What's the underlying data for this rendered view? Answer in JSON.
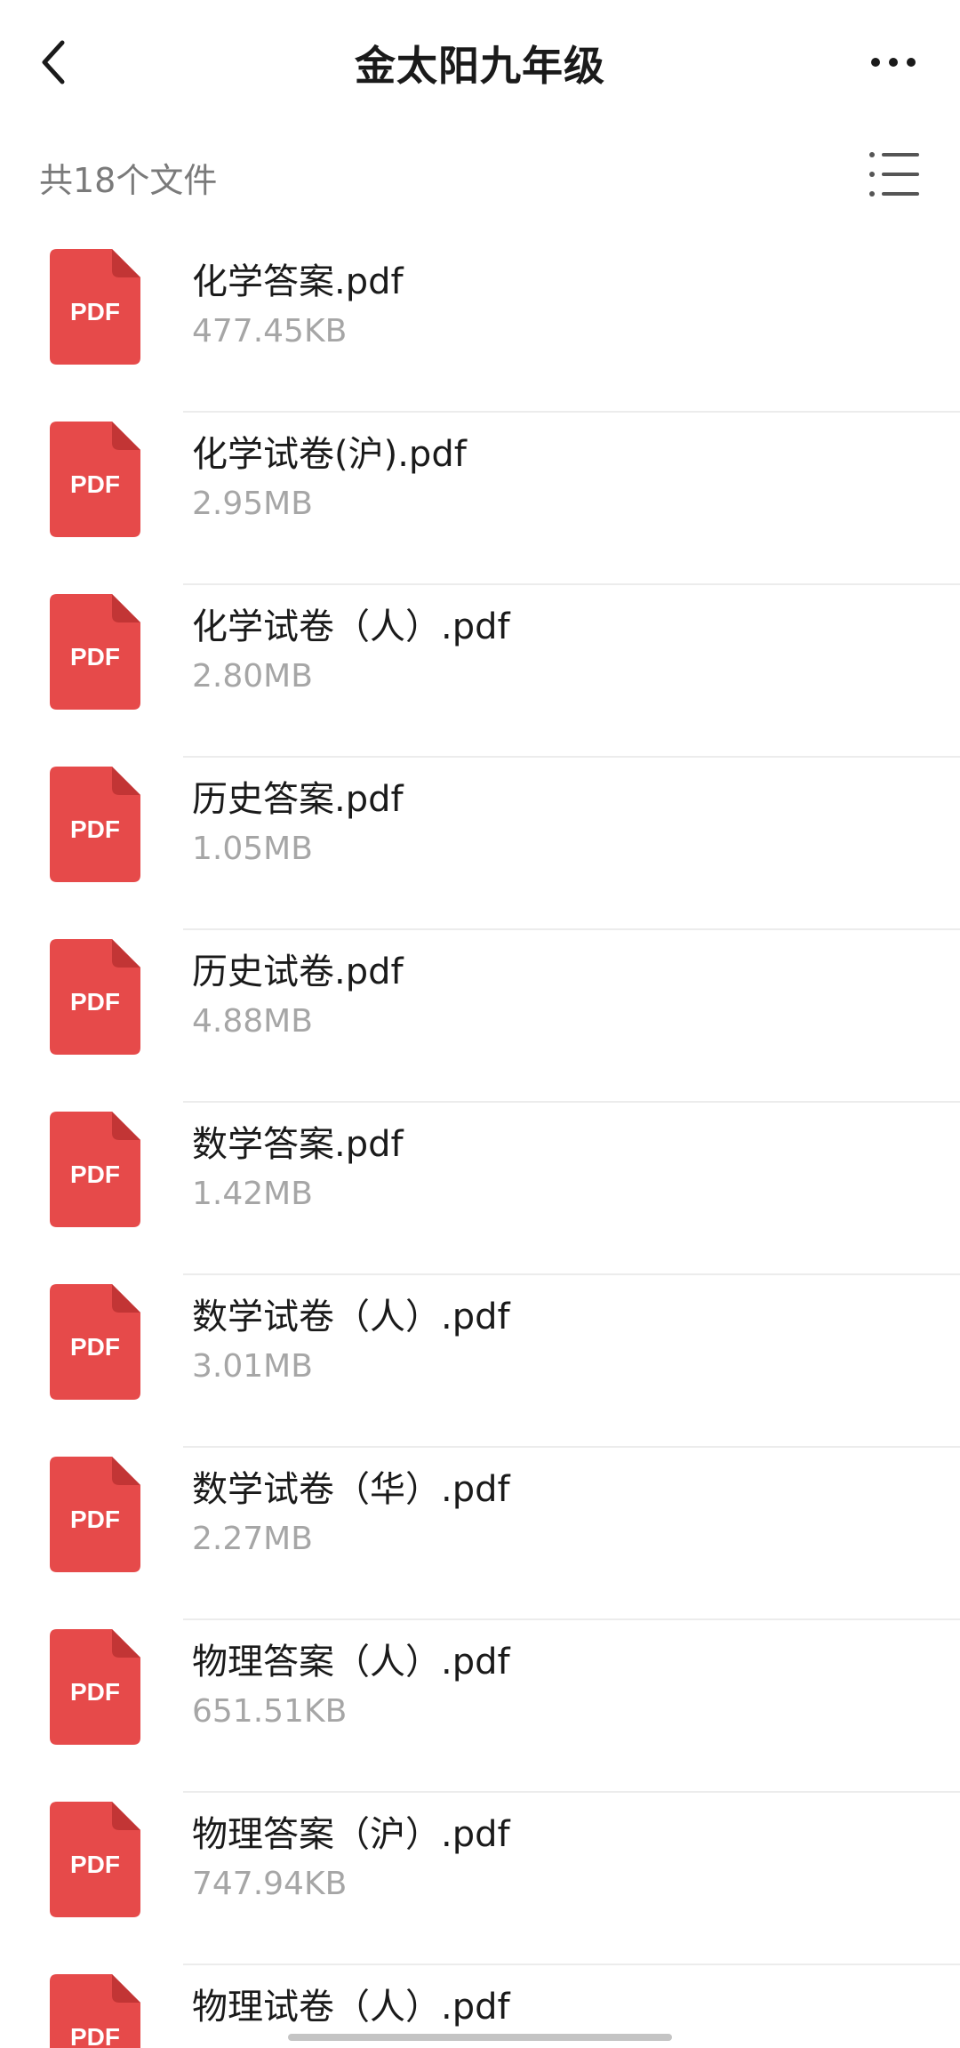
{
  "header": {
    "title": "金太阳九年级",
    "back_icon": "chevron-left-icon",
    "more_icon": "more-horizontal-icon"
  },
  "summary": {
    "file_count_label": "共18个文件",
    "view_toggle_icon": "list-view-icon"
  },
  "colors": {
    "pdf_icon": "#e64a4a",
    "pdf_icon_fold": "#c23535",
    "size_text": "#a6a6a6",
    "count_text": "#7a7a7a"
  },
  "files": [
    {
      "name": "化学答案.pdf",
      "size": "477.45KB",
      "icon_label": "PDF"
    },
    {
      "name": "化学试卷(沪).pdf",
      "size": "2.95MB",
      "icon_label": "PDF"
    },
    {
      "name": "化学试卷（人）.pdf",
      "size": "2.80MB",
      "icon_label": "PDF"
    },
    {
      "name": "历史答案.pdf",
      "size": "1.05MB",
      "icon_label": "PDF"
    },
    {
      "name": "历史试卷.pdf",
      "size": "4.88MB",
      "icon_label": "PDF"
    },
    {
      "name": "数学答案.pdf",
      "size": "1.42MB",
      "icon_label": "PDF"
    },
    {
      "name": "数学试卷（人）.pdf",
      "size": "3.01MB",
      "icon_label": "PDF"
    },
    {
      "name": "数学试卷（华）.pdf",
      "size": "2.27MB",
      "icon_label": "PDF"
    },
    {
      "name": "物理答案（人）.pdf",
      "size": "651.51KB",
      "icon_label": "PDF"
    },
    {
      "name": "物理答案（沪）.pdf",
      "size": "747.94KB",
      "icon_label": "PDF"
    },
    {
      "name": "物理试卷（人）.pdf",
      "size": "",
      "icon_label": "PDF"
    }
  ]
}
